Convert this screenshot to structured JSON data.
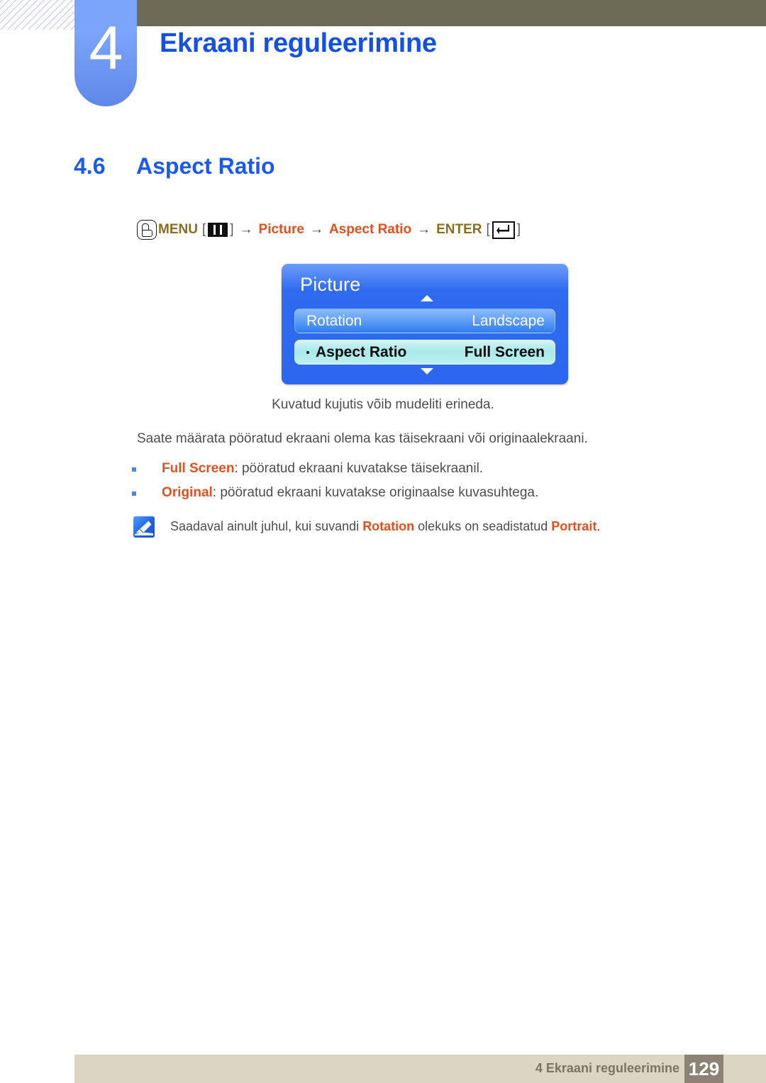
{
  "header": {
    "chapter_number": "4",
    "chapter_title": "Ekraani reguleerimine"
  },
  "section": {
    "number": "4.6",
    "title": "Aspect Ratio"
  },
  "menu_path": {
    "touch_icon": "touch-hand-icon",
    "menu_label": "MENU",
    "bracket_open": "[",
    "bracket_close": "]",
    "menu_key_icon": "menu-bars-icon",
    "arrow": "→",
    "step_picture": "Picture",
    "step_aspect_ratio": "Aspect Ratio",
    "enter_label": "ENTER",
    "enter_key_icon": "enter-arrow-icon"
  },
  "osd": {
    "title": "Picture",
    "scroll_up_icon": "triangle-up-icon",
    "scroll_down_icon": "triangle-down-icon",
    "rows": [
      {
        "label": "Rotation",
        "value": "Landscape",
        "selected": false
      },
      {
        "label": "Aspect Ratio",
        "value": "Full Screen",
        "selected": true
      }
    ]
  },
  "content": {
    "caption": "Kuvatud kujutis võib mudeliti erineda.",
    "intro": "Saate määrata pööratud ekraani olema kas täisekraani või originaalekraani.",
    "bullets": [
      {
        "term": "Full Screen",
        "rest": ": pööratud ekraani kuvatakse täisekraanil."
      },
      {
        "term": "Original",
        "rest": ": pööratud ekraani kuvatakse originaalse kuvasuhtega."
      }
    ],
    "note": {
      "icon": "note-pen-icon",
      "part1": "Saadaval ainult juhul, kui suvandi ",
      "hl1": "Rotation",
      "part2": " olekuks on seadistatud ",
      "hl2": "Portrait",
      "part3": "."
    }
  },
  "footer": {
    "text": "4 Ekraani reguleerimine",
    "page_number": "129"
  },
  "colors": {
    "accent_blue": "#1a5af0",
    "chapter_badge": "#7ba4fb",
    "header_bar": "#6d6a55",
    "orange": "#e2511d",
    "gold": "#8a6d1f",
    "footer_bar": "#dbd5c3",
    "footer_page_box": "#8d8276",
    "osd_blue": "#2b68ef",
    "osd_selected": "#a7e9ea"
  }
}
